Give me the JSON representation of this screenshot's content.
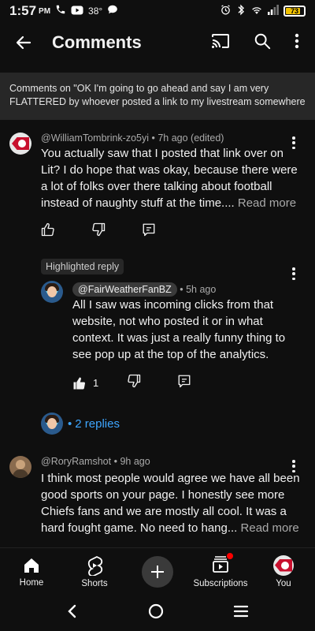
{
  "status_bar": {
    "time": "1:57",
    "ampm": "PM",
    "temperature": "38°",
    "battery": "73"
  },
  "app_bar": {
    "title": "Comments"
  },
  "context": {
    "line1": "Comments on \"OK I'm going to go ahead and say I am very",
    "line2": "FLATTERED by whoever posted a link to my livestream somewhere ..."
  },
  "comments": [
    {
      "author": "@WilliamTombrink-zo5yi",
      "time": "7h ago (edited)",
      "lines": [
        "You actually saw that I posted that link over on",
        "Lit? I do hope that was okay, because there were",
        "a lot of folks over there talking about football",
        "instead of naughty stuff at the time.... "
      ],
      "read_more": "Read more"
    },
    {
      "highlight_label": "Highlighted reply",
      "author": "@FairWeatherFanBZ",
      "time": "5h ago",
      "lines": [
        "All I saw was incoming clicks from that",
        "website, not who posted it or in what",
        "context. It was just a really funny thing to",
        "see pop up at the top of the analytics."
      ],
      "likes": "1",
      "replies_label": "2 replies"
    },
    {
      "author": "@RoryRamshot",
      "time": "9h ago",
      "lines": [
        "I think most people would agree we have all been",
        "good sports on your page. I honestly see more",
        "Chiefs fans and we are mostly all cool. It was a",
        "hard fought game. No need to hang... "
      ],
      "read_more": "Read more"
    }
  ],
  "bottom_nav": {
    "home": "Home",
    "shorts": "Shorts",
    "subscriptions": "Subscriptions",
    "you": "You"
  }
}
